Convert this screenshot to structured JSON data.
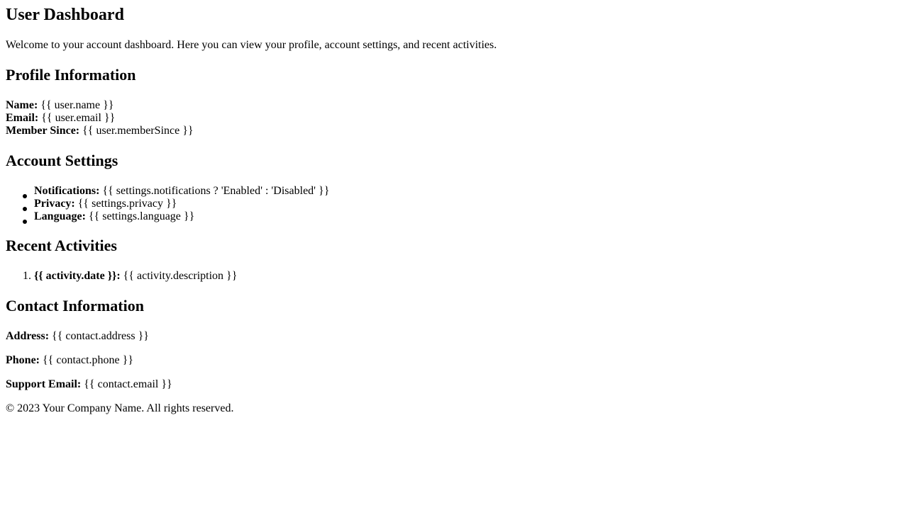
{
  "header": {
    "title": "User Dashboard",
    "intro": "Welcome to your account dashboard. Here you can view your profile, account settings, and recent activities."
  },
  "profile": {
    "heading": "Profile Information",
    "rows": [
      {
        "label": "Name:",
        "value": "{{ user.name }}"
      },
      {
        "label": "Email:",
        "value": "{{ user.email }}"
      },
      {
        "label": "Member Since:",
        "value": "{{ user.memberSince }}"
      }
    ]
  },
  "settings": {
    "heading": "Account Settings",
    "items": [
      {
        "label": "Notifications:",
        "value": "{{ settings.notifications ? 'Enabled' : 'Disabled' }}"
      },
      {
        "label": "Privacy:",
        "value": "{{ settings.privacy }}"
      },
      {
        "label": "Language:",
        "value": "{{ settings.language }}"
      }
    ]
  },
  "activities": {
    "heading": "Recent Activities",
    "items": [
      {
        "number": "1.",
        "label": "{{ activity.date }}:",
        "value": "{{ activity.description }}"
      }
    ]
  },
  "contact": {
    "heading": "Contact Information",
    "rows": [
      {
        "label": "Address:",
        "value": "{{ contact.address }}"
      },
      {
        "label": "Phone:",
        "value": "{{ contact.phone }}"
      },
      {
        "label": "Support Email:",
        "value": "{{ contact.email }}"
      }
    ]
  },
  "footer": {
    "copyright": "© 2023 Your Company Name. All rights reserved."
  }
}
